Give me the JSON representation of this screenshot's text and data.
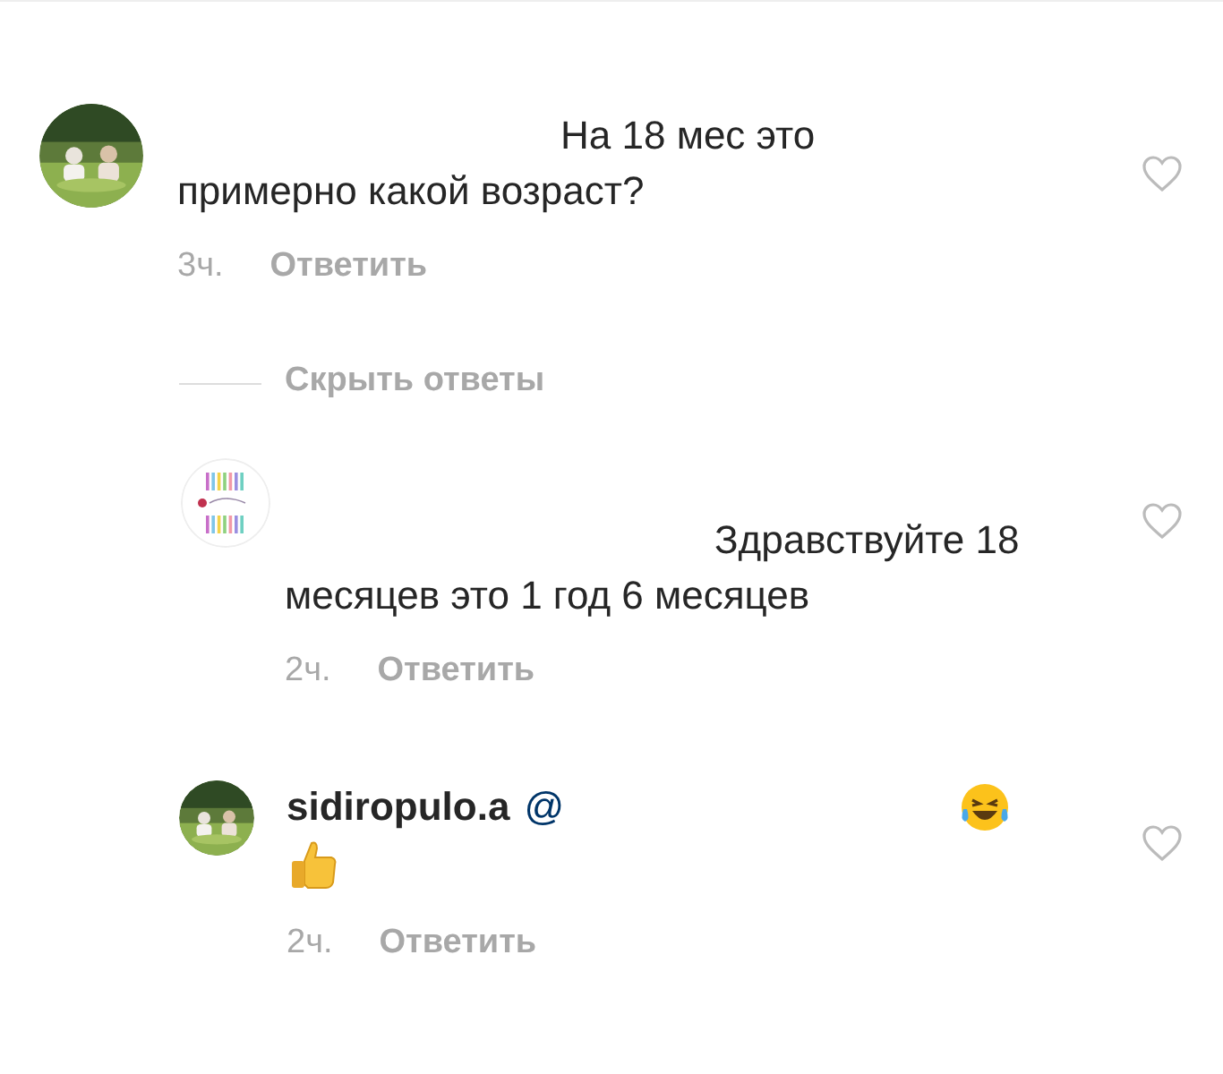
{
  "comment": {
    "body": "На 18 мес это примерно какой возраст?",
    "time": "3ч.",
    "reply_label": "Ответить",
    "liked": false
  },
  "hide_replies": "Скрыть ответы",
  "replies": [
    {
      "avatar": {
        "kind": "logo"
      },
      "body": "Здравствуйте 18 месяцев это 1 год 6 месяцев",
      "time": "2ч.",
      "reply_label": "Ответить",
      "liked": false
    },
    {
      "username": "sidiropulo.a",
      "mention": "@",
      "emoji": [
        {
          "kind": "laughing"
        },
        {
          "kind": "thumbs-up"
        }
      ],
      "time": "2ч.",
      "reply_label": "Ответить",
      "liked": false
    }
  ]
}
